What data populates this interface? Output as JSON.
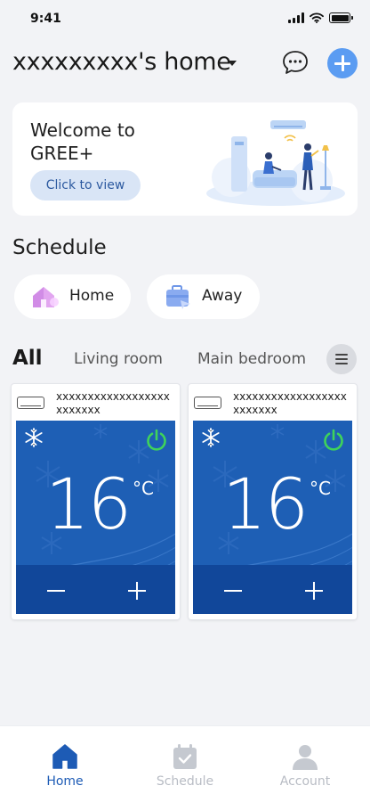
{
  "status_bar": {
    "time": "9:41"
  },
  "header": {
    "home_name": "xxxxxxxxx's home"
  },
  "welcome": {
    "title": "Welcome to GREE+",
    "cta_label": "Click to view"
  },
  "schedule": {
    "title": "Schedule",
    "scenes": [
      {
        "label": "Home",
        "icon": "house-scene-icon"
      },
      {
        "label": "Away",
        "icon": "suitcase-scene-icon"
      }
    ]
  },
  "rooms": {
    "tabs": [
      "All",
      "Living room",
      "Main bedroom"
    ],
    "active": "All"
  },
  "devices": [
    {
      "name": "xxxxxxxxxxxxxxxxxxxxxxxxx",
      "mode": "cool",
      "power": "on",
      "temperature": "16",
      "unit": "°C"
    },
    {
      "name": "xxxxxxxxxxxxxxxxxxxxxxxxx",
      "mode": "cool",
      "power": "on",
      "temperature": "16",
      "unit": "°C"
    }
  ],
  "nav": {
    "items": [
      {
        "label": "Home",
        "icon": "home-icon",
        "active": true
      },
      {
        "label": "Schedule",
        "icon": "calendar-check-icon",
        "active": false
      },
      {
        "label": "Account",
        "icon": "person-icon",
        "active": false
      }
    ]
  },
  "colors": {
    "accent": "#1d5bb5",
    "add_button": "#5b9cf2",
    "device_panel": "#1e5fb5",
    "power_on": "#3fd35a",
    "background": "#f2f3f6"
  }
}
